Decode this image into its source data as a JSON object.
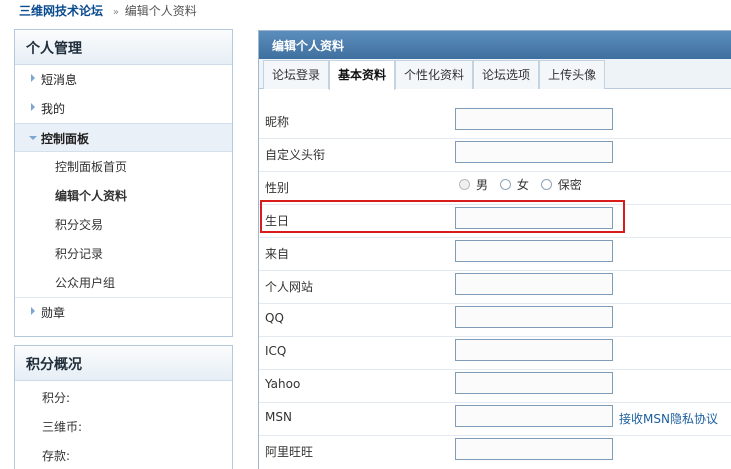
{
  "breadcrumb": {
    "home": "三维网技术论坛",
    "separator": "»",
    "current": "编辑个人资料"
  },
  "sidebar": {
    "manage_title": "个人管理",
    "menu": [
      {
        "label": "短消息"
      },
      {
        "label": "我的"
      },
      {
        "label": "控制面板"
      }
    ],
    "sub_items": [
      {
        "label": "控制面板首页"
      },
      {
        "label": "编辑个人资料"
      },
      {
        "label": "积分交易"
      },
      {
        "label": "积分记录"
      },
      {
        "label": "公众用户组"
      }
    ],
    "medal": "勋章",
    "points_title": "积分概况",
    "points": [
      {
        "label": "积分:"
      },
      {
        "label": "三维币:"
      },
      {
        "label": "存款:"
      }
    ]
  },
  "main": {
    "title": "编辑个人资料",
    "tabs": [
      {
        "label": "论坛登录"
      },
      {
        "label": "基本资料"
      },
      {
        "label": "个性化资料"
      },
      {
        "label": "论坛选项"
      },
      {
        "label": "上传头像"
      }
    ],
    "fields": {
      "nickname": {
        "label": "昵称",
        "value": ""
      },
      "custom_title": {
        "label": "自定义头衔",
        "value": ""
      },
      "gender": {
        "label": "性别",
        "options": [
          "男",
          "女",
          "保密"
        ]
      },
      "birthday": {
        "label": "生日",
        "value": ""
      },
      "from": {
        "label": "来自",
        "value": ""
      },
      "website": {
        "label": "个人网站",
        "value": ""
      },
      "qq": {
        "label": "QQ",
        "value": ""
      },
      "icq": {
        "label": "ICQ",
        "value": ""
      },
      "yahoo": {
        "label": "Yahoo",
        "value": ""
      },
      "msn": {
        "label": "MSN",
        "value": "",
        "link": "接收MSN隐私协议"
      },
      "aliwangwang": {
        "label": "阿里旺旺",
        "value": ""
      }
    }
  },
  "colors": {
    "header_bar": "#4a7cac",
    "highlight_border": "#d81b1b",
    "link": "#1b5e9e"
  }
}
